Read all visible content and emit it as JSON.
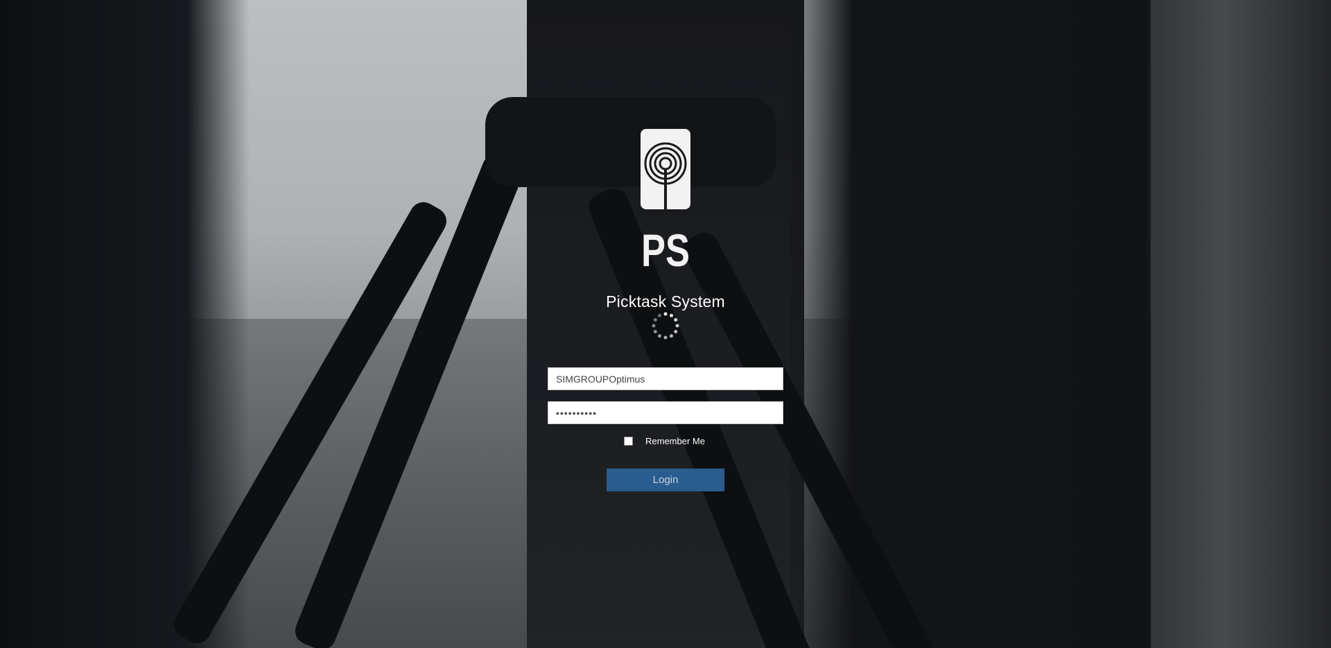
{
  "app": {
    "title": "Picktask System",
    "logo_text": "PS"
  },
  "login": {
    "username_value": "SIMGROUPOptimus",
    "password_value": "••••••••••",
    "remember_label": "Remember Me",
    "remember_checked": false,
    "submit_label": "Login"
  },
  "icons": {
    "logo": "ps-target-logo-icon",
    "loading": "loading-spinner-icon"
  },
  "colors": {
    "accent": "#2a5d8f",
    "text_light": "#ffffff"
  }
}
